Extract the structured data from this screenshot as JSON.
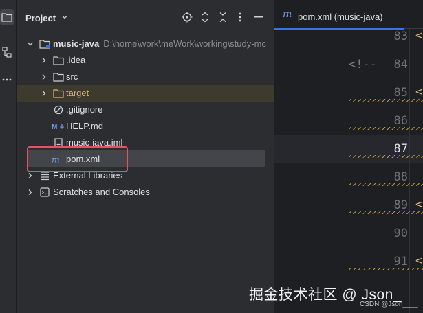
{
  "project_panel": {
    "title": "Project",
    "tree": [
      {
        "label": "music-java",
        "path": "D:\\home\\work\\meWork\\working\\study-mc",
        "icon": "module-folder-icon"
      },
      {
        "label": ".idea",
        "icon": "folder-icon"
      },
      {
        "label": "src",
        "icon": "folder-icon"
      },
      {
        "label": "target",
        "icon": "folder-icon"
      },
      {
        "label": ".gitignore",
        "icon": "gitignore-icon"
      },
      {
        "label": "HELP.md",
        "icon": "markdown-icon"
      },
      {
        "label": "music-java.iml",
        "icon": "iml-file-icon"
      },
      {
        "label": "pom.xml",
        "icon": "maven-icon"
      },
      {
        "label": "External Libraries",
        "icon": "libraries-icon"
      },
      {
        "label": "Scratches and Consoles",
        "icon": "scratches-icon"
      }
    ]
  },
  "editor": {
    "tab_label": "pom.xml (music-java)",
    "line_numbers": [
      "83",
      "84",
      "85",
      "86",
      "87",
      "88",
      "89",
      "90",
      "91"
    ],
    "line84_text": "<!--",
    "tag_open": "<"
  },
  "watermark": {
    "main": "掘金技术社区 @ Json_",
    "sub": "CSDN @Json____"
  },
  "colors": {
    "panel_bg": "#2b2d30",
    "editor_bg": "#1e1f22",
    "selection_frame": "#e5545e",
    "tab_underline": "#3574f0",
    "target_folder": "#d5b778"
  }
}
